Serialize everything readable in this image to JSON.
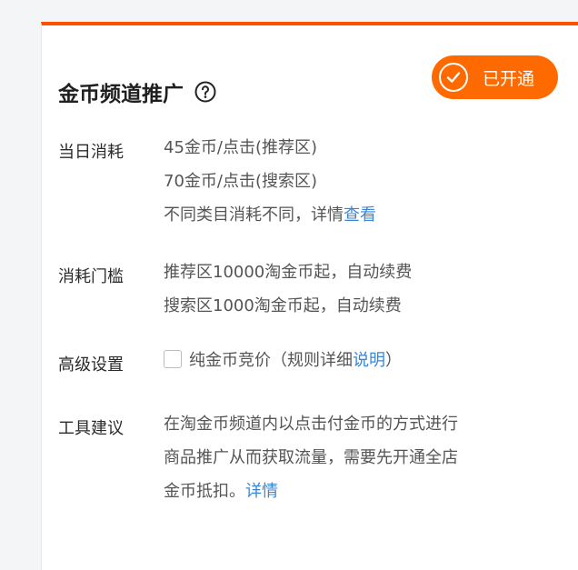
{
  "header": {
    "title": "金币频道推广",
    "status_badge": "已开通",
    "accent_color": "#ff5000"
  },
  "rows": {
    "daily_cost": {
      "label": "当日消耗",
      "line1": "45金币/点击(推荐区)",
      "line2": "70金币/点击(搜索区)",
      "line3_text": "不同类目消耗不同，详情",
      "line3_link": "查看"
    },
    "threshold": {
      "label": "消耗门槛",
      "line1": "推荐区10000淘金币起，自动续费",
      "line2": "搜索区1000淘金币起，自动续费"
    },
    "advanced": {
      "label": "高级设置",
      "checkbox_label": "纯金币竞价（规则详细",
      "checkbox_link": "说明",
      "checkbox_suffix": "）",
      "checkbox_checked": false
    },
    "suggestion": {
      "label": "工具建议",
      "line1": "在淘金币频道内以点击付金币的方式进行",
      "line2": "商品推广从而获取流量，需要先开通全店",
      "line3_text": "金币抵扣。",
      "line3_link": "详情"
    }
  },
  "icons": {
    "help": "question-circle-icon",
    "check": "check-circle-icon"
  },
  "colors": {
    "badge": "#ff6a00",
    "link": "#3a86d6"
  }
}
